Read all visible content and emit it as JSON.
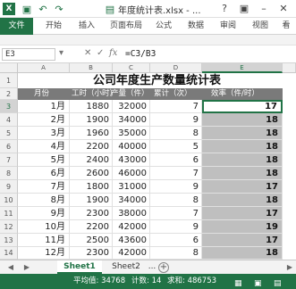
{
  "titlebar": {
    "title": "年度统计表.xlsx - ...",
    "quick_access": [
      {
        "icon": "excel-icon",
        "glyph": "X"
      },
      {
        "icon": "save-icon",
        "glyph": "▣"
      },
      {
        "icon": "undo-icon",
        "glyph": "↶"
      },
      {
        "icon": "redo-icon",
        "glyph": "↷"
      },
      {
        "icon": "file-icon",
        "glyph": "▤"
      }
    ],
    "controls": {
      "help": "?",
      "ribbon_options": "▣",
      "minimize": "–",
      "close": "✕"
    }
  },
  "ribbon": {
    "tabs": [
      "文件",
      "开始",
      "插入",
      "页面布局",
      "公式",
      "数据",
      "审阅",
      "视图",
      "看"
    ]
  },
  "formula_bar": {
    "name_box": "E3",
    "name_box_arrow": "▾",
    "cancel": "✕",
    "enter": "✓",
    "fx": "fx",
    "formula": "=C3/B3"
  },
  "columns": [
    "A",
    "B",
    "C",
    "D",
    "E"
  ],
  "rows": [
    "1",
    "2",
    "3",
    "4",
    "5",
    "6",
    "7",
    "8",
    "9",
    "10",
    "11",
    "12",
    "13",
    "14"
  ],
  "sheet": {
    "title": "公司年度生产数量统计表",
    "headers": [
      "月份",
      "工时（小时）",
      "产量（件）",
      "累计（次）",
      "效率（件/时）"
    ],
    "data": [
      {
        "month": "1月",
        "hours": "1880",
        "output": "32000",
        "count": "7",
        "rate": "17"
      },
      {
        "month": "2月",
        "hours": "1900",
        "output": "34000",
        "count": "9",
        "rate": "18"
      },
      {
        "month": "3月",
        "hours": "1960",
        "output": "35000",
        "count": "8",
        "rate": "18"
      },
      {
        "month": "4月",
        "hours": "2200",
        "output": "40000",
        "count": "5",
        "rate": "18"
      },
      {
        "month": "5月",
        "hours": "2400",
        "output": "43000",
        "count": "6",
        "rate": "18"
      },
      {
        "month": "6月",
        "hours": "2600",
        "output": "46000",
        "count": "7",
        "rate": "18"
      },
      {
        "month": "7月",
        "hours": "1800",
        "output": "31000",
        "count": "9",
        "rate": "17"
      },
      {
        "month": "8月",
        "hours": "1900",
        "output": "34000",
        "count": "8",
        "rate": "18"
      },
      {
        "month": "9月",
        "hours": "2300",
        "output": "38000",
        "count": "7",
        "rate": "17"
      },
      {
        "month": "10月",
        "hours": "2200",
        "output": "42000",
        "count": "9",
        "rate": "19"
      },
      {
        "month": "11月",
        "hours": "2500",
        "output": "43600",
        "count": "6",
        "rate": "17"
      },
      {
        "month": "12月",
        "hours": "2300",
        "output": "42000",
        "count": "8",
        "rate": "18"
      }
    ]
  },
  "sheet_tabs": {
    "prev": "◀",
    "next": "▶",
    "tabs": [
      "Sheet1",
      "Sheet2"
    ],
    "more": "...",
    "add": "+"
  },
  "status_bar": {
    "average": "平均值: 34768",
    "count": "计数: 14",
    "sum": "求和: 486753",
    "views": [
      "▦",
      "▣",
      "▤"
    ]
  },
  "colors": {
    "accent": "#217346",
    "header_fill": "#7a7a7a",
    "rate_fill": "#bfbfbf"
  }
}
